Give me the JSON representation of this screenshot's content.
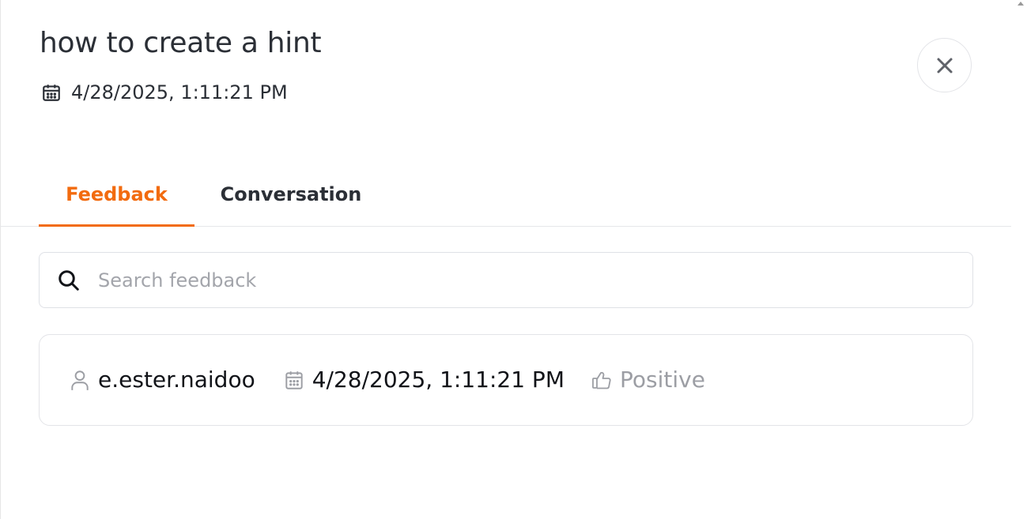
{
  "header": {
    "title": "how to create a hint",
    "date": "4/28/2025, 1:11:21 PM"
  },
  "tabs": [
    {
      "label": "Feedback",
      "active": true
    },
    {
      "label": "Conversation",
      "active": false
    }
  ],
  "search": {
    "placeholder": "Search feedback",
    "value": ""
  },
  "feedback_items": [
    {
      "user": "e.ester.naidoo",
      "date": "4/28/2025, 1:11:21 PM",
      "sentiment": "Positive"
    }
  ],
  "icons": {
    "date": "calendar-icon",
    "close": "close-icon",
    "search": "search-icon",
    "user": "user-icon",
    "sentiment": "thumbs-up-icon"
  },
  "colors": {
    "accent": "#f26b0f",
    "text": "#2b2f36",
    "muted": "#9c9ea4",
    "border": "#e3e4e8"
  }
}
